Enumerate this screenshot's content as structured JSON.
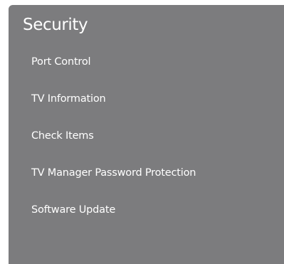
{
  "panel": {
    "title": "Security",
    "background_color": "#7c7c7e",
    "text_color": "#ffffff",
    "items": [
      {
        "label": "Port Control"
      },
      {
        "label": "TV Information"
      },
      {
        "label": "Check Items"
      },
      {
        "label": "TV Manager Password Protection"
      },
      {
        "label": "Software Update"
      }
    ]
  }
}
